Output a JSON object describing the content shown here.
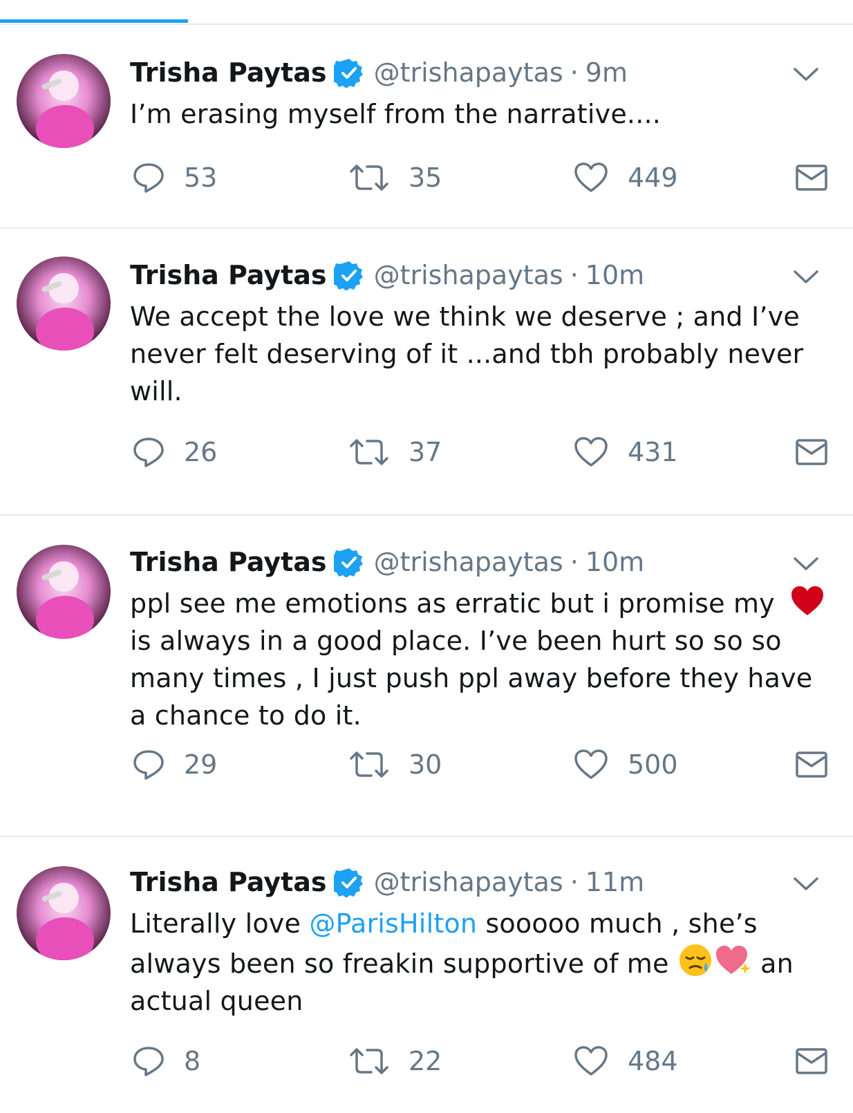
{
  "colors": {
    "accent": "#1da1f2",
    "muted": "#657786",
    "text": "#14171a",
    "divider": "#e6ecf0",
    "heart_emoji": "#d0021b"
  },
  "icons": [
    "reply-icon",
    "retweet-icon",
    "like-icon",
    "dm-icon",
    "verified-icon",
    "chevron-down-icon"
  ],
  "tweets": [
    {
      "name": "Trisha Paytas",
      "handle": "@trishapaytas",
      "separator": "·",
      "time": "9m",
      "text": "I’m erasing myself from the narrative....",
      "replies": "53",
      "retweets": "35",
      "likes": "449"
    },
    {
      "name": "Trisha Paytas",
      "handle": "@trishapaytas",
      "separator": "·",
      "time": "10m",
      "text": "We accept the love we think we deserve ; and I’ve never felt deserving of it ...and tbh probably never will.",
      "replies": "26",
      "retweets": "37",
      "likes": "431"
    },
    {
      "name": "Trisha Paytas",
      "handle": "@trishapaytas",
      "separator": "·",
      "time": "10m",
      "text_before": "ppl see me emotions as erratic but i promise my",
      "text_after": "is always in a good place. I’ve been hurt so so so many times , I just push ppl away before they have a chance to do it.",
      "replies": "29",
      "retweets": "30",
      "likes": "500"
    },
    {
      "name": "Trisha Paytas",
      "handle": "@trishapaytas",
      "separator": "·",
      "time": "11m",
      "text_before": "Literally love ",
      "mention": "@ParisHilton",
      "text_middle": " sooooo much , she’s always been so freakin supportive of me ",
      "text_after": " an actual queen",
      "replies": "8",
      "retweets": "22",
      "likes": "484"
    }
  ]
}
